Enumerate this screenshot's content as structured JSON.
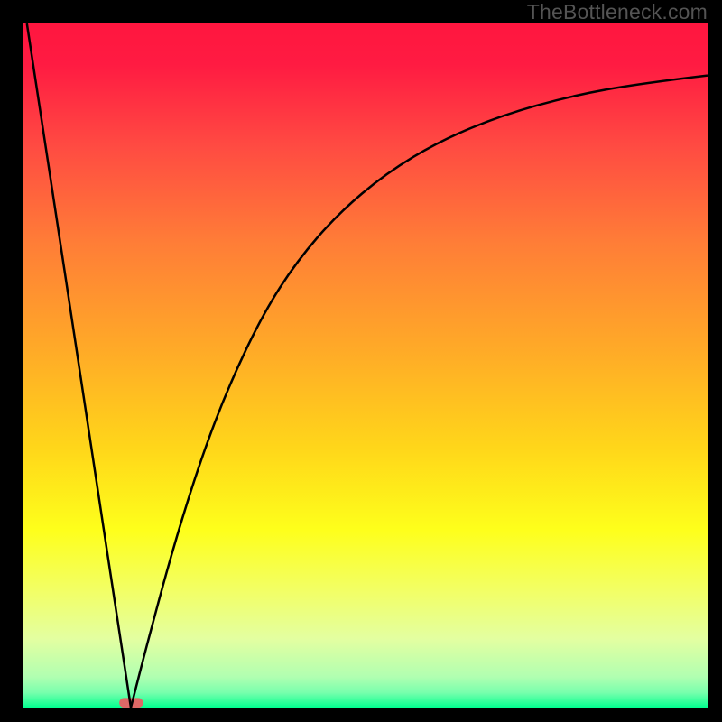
{
  "watermark": "TheBottleneck.com",
  "chart_data": {
    "type": "line",
    "title": "",
    "xlabel": "",
    "ylabel": "",
    "xlim": [
      0,
      100
    ],
    "ylim": [
      0,
      100
    ],
    "grid": false,
    "legend": false,
    "background_gradient": {
      "type": "vertical",
      "stops": [
        {
          "pos": 0.0,
          "color": "#ff163f"
        },
        {
          "pos": 0.06,
          "color": "#ff1b42"
        },
        {
          "pos": 0.18,
          "color": "#ff4b42"
        },
        {
          "pos": 0.32,
          "color": "#ff7d37"
        },
        {
          "pos": 0.48,
          "color": "#ffab27"
        },
        {
          "pos": 0.62,
          "color": "#ffd61a"
        },
        {
          "pos": 0.74,
          "color": "#feff1b"
        },
        {
          "pos": 0.83,
          "color": "#f2ff66"
        },
        {
          "pos": 0.9,
          "color": "#e3ffa1"
        },
        {
          "pos": 0.955,
          "color": "#b1ffb1"
        },
        {
          "pos": 0.978,
          "color": "#78ffad"
        },
        {
          "pos": 0.995,
          "color": "#1fff96"
        },
        {
          "pos": 1.0,
          "color": "#00ff8f"
        }
      ]
    },
    "min_marker": {
      "x_range": [
        14.0,
        17.5
      ],
      "y": 0.7,
      "color": "#de6866"
    },
    "series": [
      {
        "name": "left-branch",
        "description": "Steep linear descent from top-left toward the minimum",
        "x": [
          0.5,
          3.0,
          6.0,
          9.0,
          12.0,
          14.5,
          15.7
        ],
        "y": [
          100.0,
          83.6,
          63.9,
          44.1,
          24.3,
          7.9,
          0.0
        ]
      },
      {
        "name": "right-branch",
        "description": "Concave curve rising from the minimum and flattening toward upper-right",
        "x": [
          15.7,
          18.0,
          22.0,
          26.0,
          30.0,
          35.0,
          40.0,
          46.0,
          53.0,
          61.0,
          70.0,
          80.0,
          90.0,
          100.0
        ],
        "y": [
          0.0,
          9.0,
          23.8,
          36.5,
          47.0,
          57.5,
          65.3,
          72.2,
          78.1,
          82.9,
          86.6,
          89.4,
          91.2,
          92.4
        ]
      }
    ]
  }
}
